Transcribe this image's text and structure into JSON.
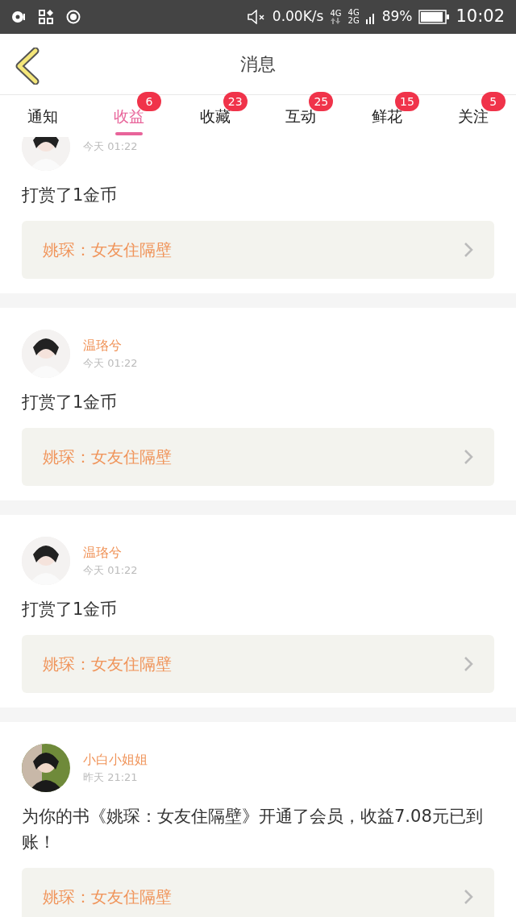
{
  "status_bar": {
    "network_speed": "0.00K/s",
    "signal_1": "4G",
    "signal_2": "4G",
    "signal_3": "2G",
    "battery": "89%",
    "time": "10:02"
  },
  "header": {
    "title": "消息"
  },
  "tabs": [
    {
      "label": "通知",
      "selected": false
    },
    {
      "label": "收益",
      "badge": "6",
      "selected": true
    },
    {
      "label": "收藏",
      "badge": "23",
      "selected": false
    },
    {
      "label": "互动",
      "badge": "25",
      "selected": false
    },
    {
      "label": "鲜花",
      "badge": "15",
      "selected": false
    },
    {
      "label": "关注",
      "badge": "5",
      "selected": false
    }
  ],
  "messages": [
    {
      "time": "今天 01:22",
      "text": "打赏了1金币",
      "book": "姚琛：女友住隔壁"
    },
    {
      "name": "温珞兮",
      "time": "今天 01:22",
      "text": "打赏了1金币",
      "book": "姚琛：女友住隔壁"
    },
    {
      "name": "温珞兮",
      "time": "今天 01:22",
      "text": "打赏了1金币",
      "book": "姚琛：女友住隔壁"
    },
    {
      "name": "小白小姐姐",
      "time": "昨天 21:21",
      "text": "为你的书《姚琛：女友住隔壁》开通了会员，收益7.08元已到账！",
      "book": "姚琛：女友住隔壁"
    }
  ]
}
